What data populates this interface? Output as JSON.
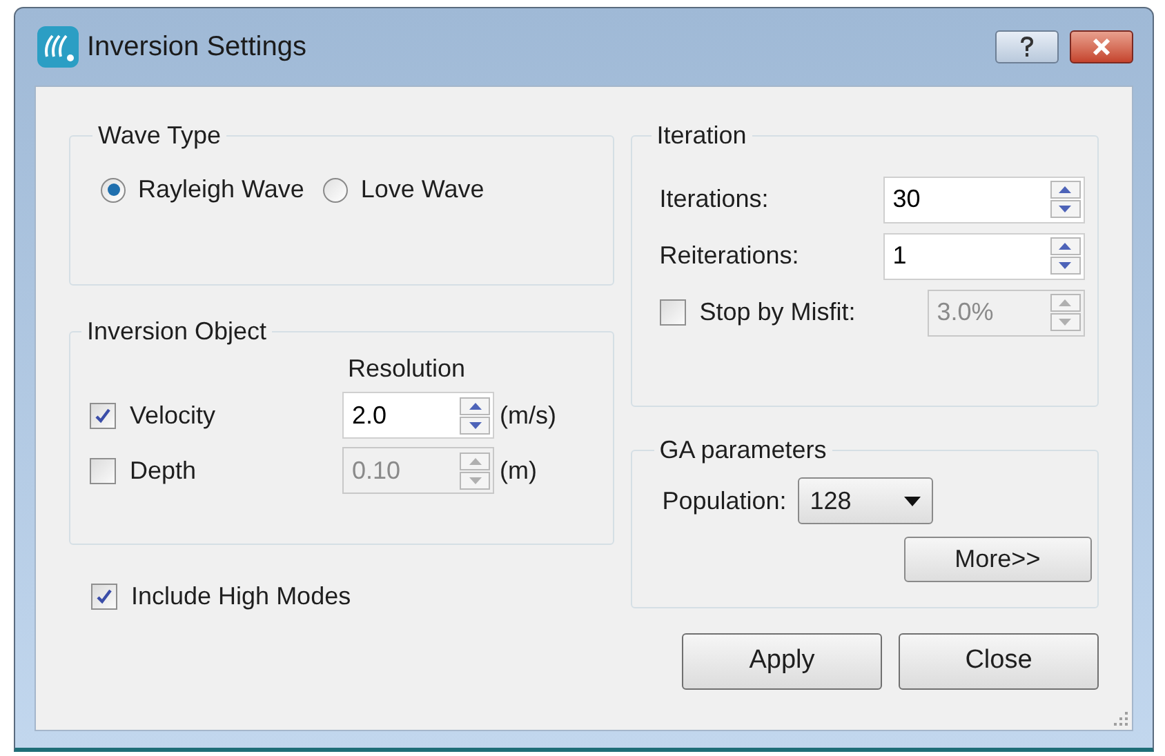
{
  "window": {
    "title": "Inversion Settings"
  },
  "wave_type": {
    "title": "Wave Type",
    "options": [
      {
        "label": "Rayleigh Wave",
        "selected": true
      },
      {
        "label": "Love Wave",
        "selected": false
      }
    ]
  },
  "inversion_object": {
    "title": "Inversion Object",
    "column_header": "Resolution",
    "rows": [
      {
        "label": "Velocity",
        "checked": true,
        "value": "2.0",
        "unit": "(m/s)",
        "disabled": false
      },
      {
        "label": "Depth",
        "checked": false,
        "value": "0.10",
        "unit": "(m)",
        "disabled": true
      }
    ]
  },
  "include_high_modes": {
    "label": "Include High Modes",
    "checked": true
  },
  "iteration": {
    "title": "Iteration",
    "fields": [
      {
        "label": "Iterations:",
        "value": "30"
      },
      {
        "label": "Reiterations:",
        "value": "1"
      }
    ],
    "stop_by_misfit": {
      "label": "Stop by Misfit:",
      "checked": false,
      "value": "3.0%",
      "disabled": true
    }
  },
  "ga_parameters": {
    "title": "GA parameters",
    "population": {
      "label": "Population:",
      "value": "128"
    },
    "more_button": "More>>"
  },
  "buttons": [
    "Apply",
    "Close"
  ]
}
